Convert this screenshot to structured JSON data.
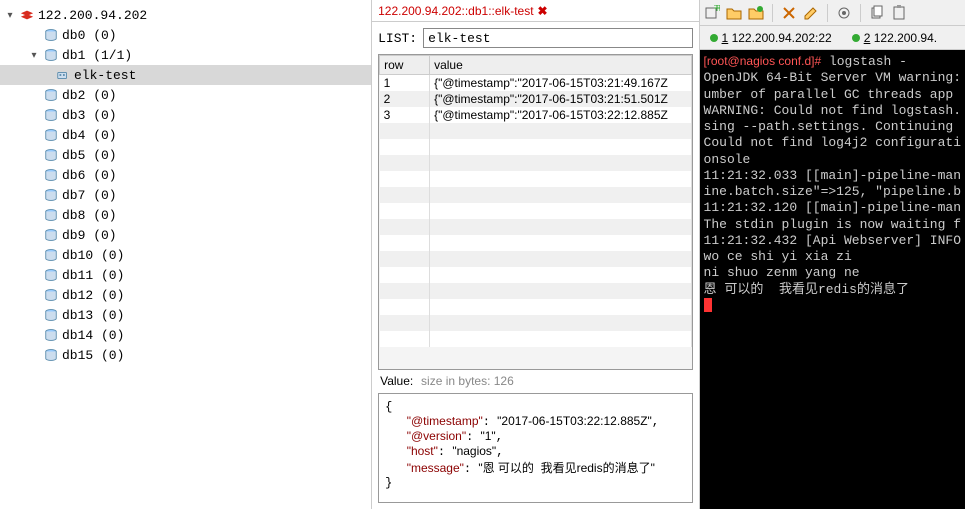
{
  "tree": {
    "root_label": "122.200.94.202",
    "db1_label": "db1  (1/1)",
    "key_label": "elk-test",
    "dbs": [
      "db0 (0)",
      "db2 (0)",
      "db3 (0)",
      "db4 (0)",
      "db5 (0)",
      "db6 (0)",
      "db7 (0)",
      "db8 (0)",
      "db9 (0)",
      "db10 (0)",
      "db11 (0)",
      "db12 (0)",
      "db13 (0)",
      "db14 (0)",
      "db15 (0)"
    ]
  },
  "crumb": "122.200.94.202::db1::elk-test",
  "list_label": "LIST:",
  "list_value": "elk-test",
  "columns": {
    "row": "row",
    "value": "value"
  },
  "rows": [
    {
      "row": "1",
      "value": "{\"@timestamp\":\"2017-06-15T03:21:49.167Z"
    },
    {
      "row": "2",
      "value": "{\"@timestamp\":\"2017-06-15T03:21:51.501Z"
    },
    {
      "row": "3",
      "value": "{\"@timestamp\":\"2017-06-15T03:22:12.885Z"
    }
  ],
  "value_label": "Value:",
  "value_hint": "size in bytes: 126",
  "json_detail": {
    "timestamp_key": "\"@timestamp\"",
    "timestamp": "\"2017-06-15T03:22:12.885Z\"",
    "version_key": "\"@version\"",
    "version": "\"1\"",
    "host_key": "\"host\"",
    "host": "\"nagios\"",
    "message_key": "\"message\"",
    "message": "\"恩 可以的  我看见redis的消息了\""
  },
  "tabs": [
    {
      "label": "122.200.94.202:22",
      "accel": "1"
    },
    {
      "label": "122.200.94.",
      "accel": "2"
    }
  ],
  "terminal": [
    "[root@nagios conf.d]# logstash -",
    "OpenJDK 64-Bit Server VM warning:",
    "umber of parallel GC threads app",
    "WARNING: Could not find logstash.",
    "sing --path.settings. Continuing",
    "Could not find log4j2 configurati",
    "onsole",
    "11:21:32.033 [[main]-pipeline-man",
    "ine.batch.size\"=>125, \"pipeline.b",
    "11:21:32.120 [[main]-pipeline-man",
    "The stdin plugin is now waiting f",
    "11:21:32.432 [Api Webserver] INFO",
    "wo ce shi yi xia zi",
    "ni shuo zenm yang ne",
    "恩 可以的  我看见redis的消息了"
  ]
}
